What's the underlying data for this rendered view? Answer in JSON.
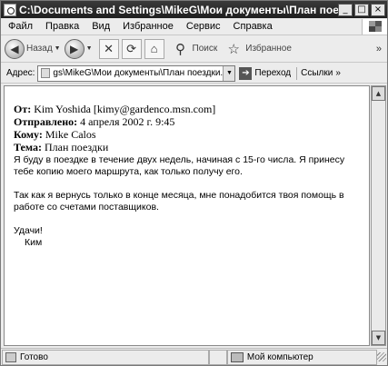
{
  "window": {
    "title": "C:\\Documents and Settings\\MikeG\\Мои документы\\План поездки...",
    "minimize_label": "_",
    "maximize_label": "□",
    "close_label": "×"
  },
  "menu": {
    "items": [
      "Файл",
      "Правка",
      "Вид",
      "Избранное",
      "Сервис",
      "Справка"
    ]
  },
  "toolbar": {
    "back_label": "Назад",
    "search_label": "Поиск",
    "favorites_label": "Избранное",
    "more_label": "»"
  },
  "address": {
    "label": "Адрес:",
    "value": "gs\\MikeG\\Мои документы\\План поездки.htm",
    "go_label": "Переход",
    "links_label": "Ссылки",
    "links_more": "»"
  },
  "message": {
    "from_label": "От:",
    "from_value": "Kim Yoshida [kimy@gardenco.msn.com]",
    "sent_label": "Отправлено:",
    "sent_value": "4 апреля 2002 г. 9:45",
    "to_label": "Кому:",
    "to_value": "Mike Calos",
    "subject_label": "Тема:",
    "subject_value": "План поездки",
    "paragraph1": "Я буду в поездке в течение двух недель, начиная с 15-го числа. Я принесу тебе копию моего маршрута, как только получу его.",
    "paragraph2": "Так как я вернусь только в конце месяца, мне понадобится твоя помощь в работе со счетами поставщиков.",
    "closing": "Удачи!",
    "signature": "Ким"
  },
  "status": {
    "main": "Готово",
    "zone": "Мой компьютер"
  }
}
